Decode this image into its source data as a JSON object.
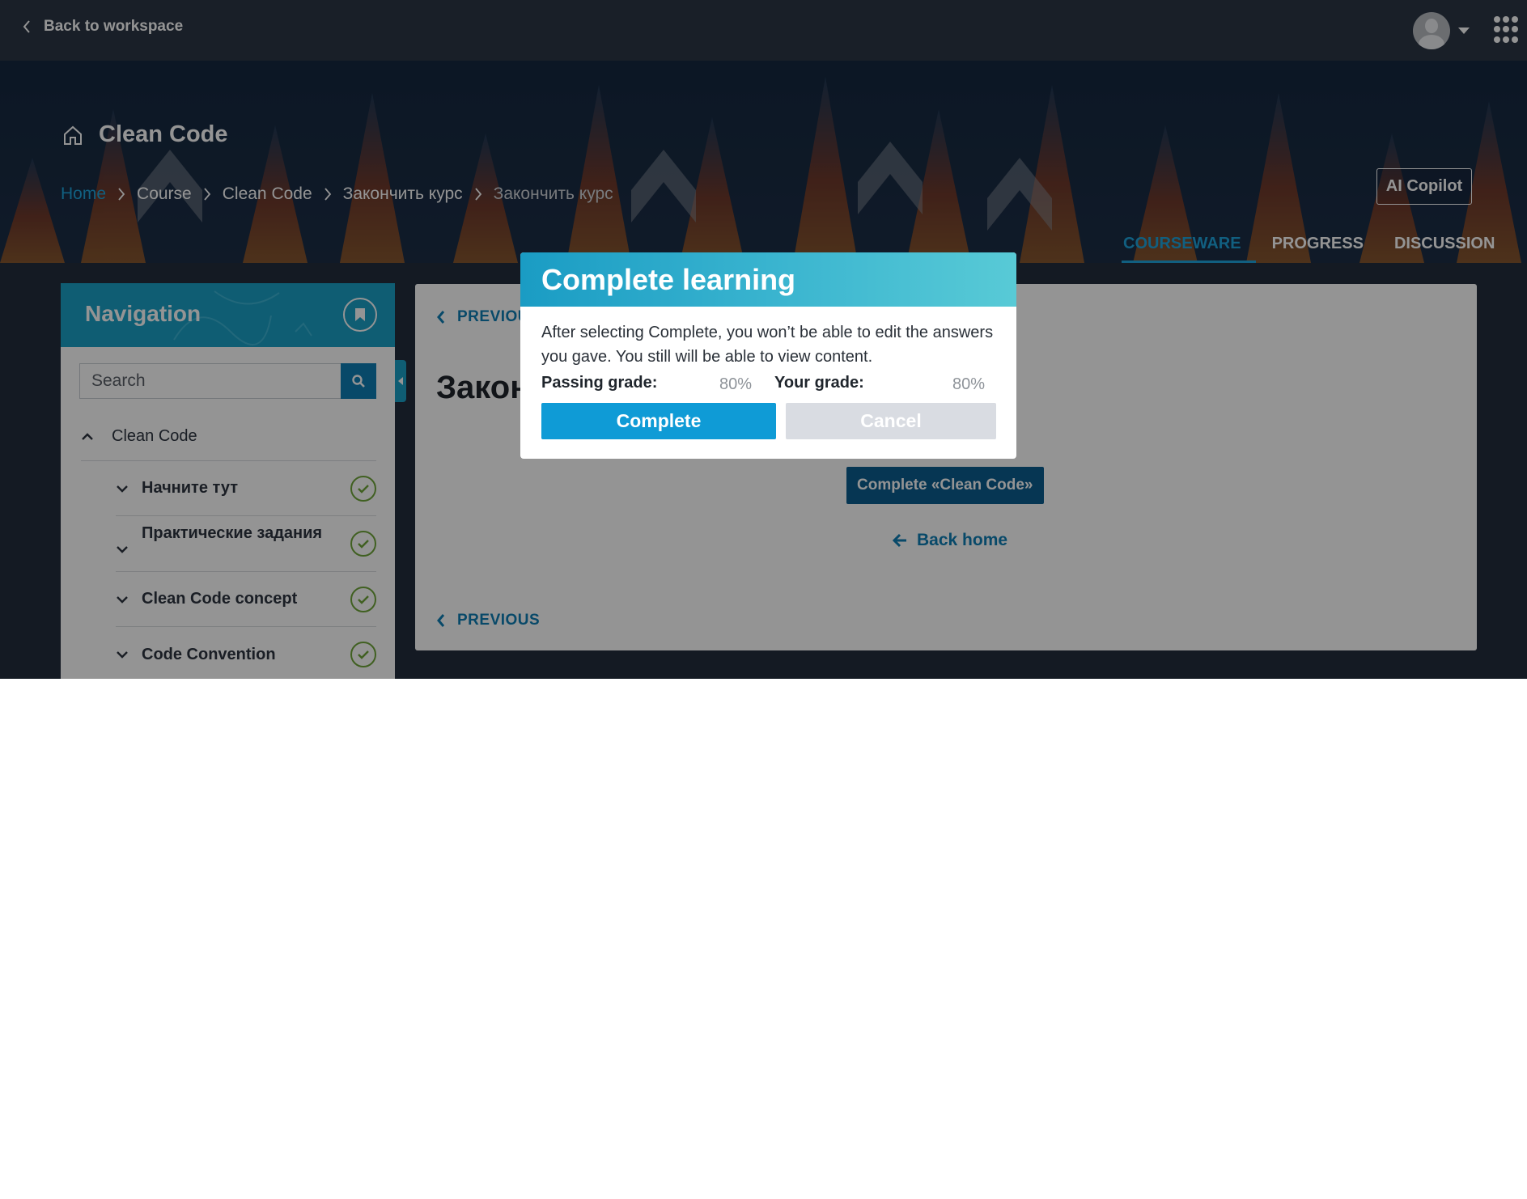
{
  "topbar": {
    "back_label": "Back to workspace",
    "back_icon": "chevron-left-icon",
    "avatar_icon": "user-avatar-icon",
    "menu_caret_icon": "caret-down-icon",
    "apps_icon": "apps-grid-icon"
  },
  "course": {
    "home_icon": "home-icon",
    "title": "Clean Code"
  },
  "breadcrumb": [
    {
      "label": "Home"
    },
    {
      "label": "Course"
    },
    {
      "label": "Clean Code"
    },
    {
      "label": "Закончить курс"
    },
    {
      "label": "Закончить курс"
    }
  ],
  "ai_copilot_label": "AI Copilot",
  "tabs": [
    {
      "label": "COURSEWARE",
      "active": true
    },
    {
      "label": "PROGRESS",
      "active": false
    },
    {
      "label": "DISCUSSION",
      "active": false
    }
  ],
  "navigation": {
    "title": "Navigation",
    "bookmark_icon": "bookmark-icon",
    "search_placeholder": "Search",
    "search_icon": "search-icon",
    "root": {
      "label": "Clean Code",
      "icon": "chevron-up-icon"
    },
    "items": [
      {
        "label": "Начните тут",
        "icon": "chevron-down-icon",
        "status_icon": "check-circle-icon"
      },
      {
        "label": "Практические задания",
        "icon": "chevron-down-icon",
        "status_icon": "check-circle-icon"
      },
      {
        "label": "Clean Code concept",
        "icon": "chevron-down-icon",
        "status_icon": "check-circle-icon"
      },
      {
        "label": "Code Convention",
        "icon": "chevron-down-icon",
        "status_icon": "check-circle-icon"
      }
    ]
  },
  "content": {
    "previous_label": "PREVIOUS",
    "unit_title": "Закончить курс",
    "complete_course_label": "Complete «Clean Code»",
    "back_home_label": "Back home"
  },
  "modal": {
    "title": "Complete learning",
    "text": "After selecting Complete, you won’t be able to edit the answers you gave. You still will be able to view content.",
    "passing_grade_label": "Passing grade:",
    "passing_grade_value": "80%",
    "your_grade_label": "Your grade:",
    "your_grade_value": "80%",
    "complete_label": "Complete",
    "cancel_label": "Cancel"
  },
  "colors": {
    "accent": "#1ea4dc",
    "dark_button": "#0b5d8f",
    "success": "#6fa53a",
    "topbar": "#2b3646"
  }
}
